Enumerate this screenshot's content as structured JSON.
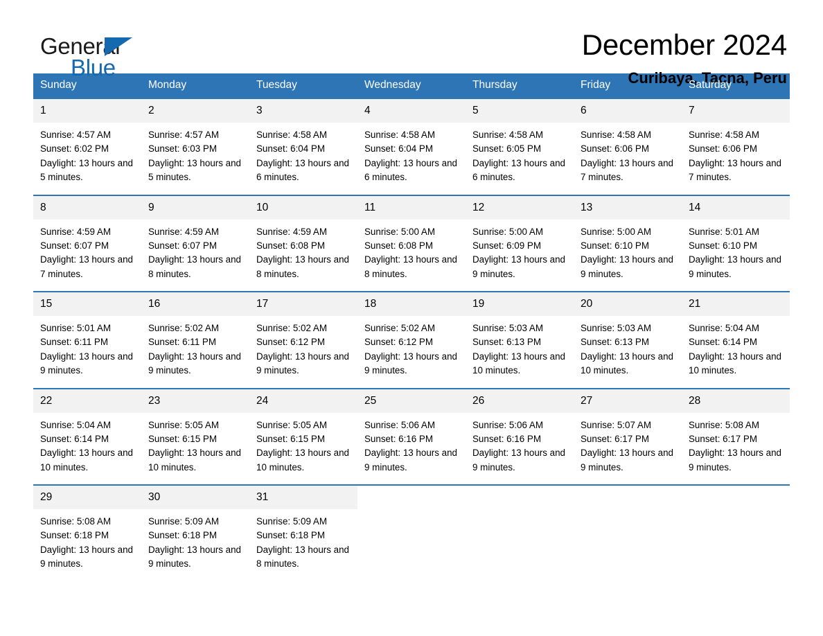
{
  "logo": {
    "word1": "General",
    "word2": "Blue",
    "accent_color": "#1569ae"
  },
  "header": {
    "title": "December 2024",
    "location": "Curibaya, Tacna, Peru"
  },
  "calendar": {
    "header_bg": "#2e75b6",
    "daynum_bg": "#f2f2f2",
    "weekdays": [
      "Sunday",
      "Monday",
      "Tuesday",
      "Wednesday",
      "Thursday",
      "Friday",
      "Saturday"
    ],
    "weeks": [
      [
        {
          "day": "1",
          "sunrise": "Sunrise: 4:57 AM",
          "sunset": "Sunset: 6:02 PM",
          "daylight": "Daylight: 13 hours and 5 minutes."
        },
        {
          "day": "2",
          "sunrise": "Sunrise: 4:57 AM",
          "sunset": "Sunset: 6:03 PM",
          "daylight": "Daylight: 13 hours and 5 minutes."
        },
        {
          "day": "3",
          "sunrise": "Sunrise: 4:58 AM",
          "sunset": "Sunset: 6:04 PM",
          "daylight": "Daylight: 13 hours and 6 minutes."
        },
        {
          "day": "4",
          "sunrise": "Sunrise: 4:58 AM",
          "sunset": "Sunset: 6:04 PM",
          "daylight": "Daylight: 13 hours and 6 minutes."
        },
        {
          "day": "5",
          "sunrise": "Sunrise: 4:58 AM",
          "sunset": "Sunset: 6:05 PM",
          "daylight": "Daylight: 13 hours and 6 minutes."
        },
        {
          "day": "6",
          "sunrise": "Sunrise: 4:58 AM",
          "sunset": "Sunset: 6:06 PM",
          "daylight": "Daylight: 13 hours and 7 minutes."
        },
        {
          "day": "7",
          "sunrise": "Sunrise: 4:58 AM",
          "sunset": "Sunset: 6:06 PM",
          "daylight": "Daylight: 13 hours and 7 minutes."
        }
      ],
      [
        {
          "day": "8",
          "sunrise": "Sunrise: 4:59 AM",
          "sunset": "Sunset: 6:07 PM",
          "daylight": "Daylight: 13 hours and 7 minutes."
        },
        {
          "day": "9",
          "sunrise": "Sunrise: 4:59 AM",
          "sunset": "Sunset: 6:07 PM",
          "daylight": "Daylight: 13 hours and 8 minutes."
        },
        {
          "day": "10",
          "sunrise": "Sunrise: 4:59 AM",
          "sunset": "Sunset: 6:08 PM",
          "daylight": "Daylight: 13 hours and 8 minutes."
        },
        {
          "day": "11",
          "sunrise": "Sunrise: 5:00 AM",
          "sunset": "Sunset: 6:08 PM",
          "daylight": "Daylight: 13 hours and 8 minutes."
        },
        {
          "day": "12",
          "sunrise": "Sunrise: 5:00 AM",
          "sunset": "Sunset: 6:09 PM",
          "daylight": "Daylight: 13 hours and 9 minutes."
        },
        {
          "day": "13",
          "sunrise": "Sunrise: 5:00 AM",
          "sunset": "Sunset: 6:10 PM",
          "daylight": "Daylight: 13 hours and 9 minutes."
        },
        {
          "day": "14",
          "sunrise": "Sunrise: 5:01 AM",
          "sunset": "Sunset: 6:10 PM",
          "daylight": "Daylight: 13 hours and 9 minutes."
        }
      ],
      [
        {
          "day": "15",
          "sunrise": "Sunrise: 5:01 AM",
          "sunset": "Sunset: 6:11 PM",
          "daylight": "Daylight: 13 hours and 9 minutes."
        },
        {
          "day": "16",
          "sunrise": "Sunrise: 5:02 AM",
          "sunset": "Sunset: 6:11 PM",
          "daylight": "Daylight: 13 hours and 9 minutes."
        },
        {
          "day": "17",
          "sunrise": "Sunrise: 5:02 AM",
          "sunset": "Sunset: 6:12 PM",
          "daylight": "Daylight: 13 hours and 9 minutes."
        },
        {
          "day": "18",
          "sunrise": "Sunrise: 5:02 AM",
          "sunset": "Sunset: 6:12 PM",
          "daylight": "Daylight: 13 hours and 9 minutes."
        },
        {
          "day": "19",
          "sunrise": "Sunrise: 5:03 AM",
          "sunset": "Sunset: 6:13 PM",
          "daylight": "Daylight: 13 hours and 10 minutes."
        },
        {
          "day": "20",
          "sunrise": "Sunrise: 5:03 AM",
          "sunset": "Sunset: 6:13 PM",
          "daylight": "Daylight: 13 hours and 10 minutes."
        },
        {
          "day": "21",
          "sunrise": "Sunrise: 5:04 AM",
          "sunset": "Sunset: 6:14 PM",
          "daylight": "Daylight: 13 hours and 10 minutes."
        }
      ],
      [
        {
          "day": "22",
          "sunrise": "Sunrise: 5:04 AM",
          "sunset": "Sunset: 6:14 PM",
          "daylight": "Daylight: 13 hours and 10 minutes."
        },
        {
          "day": "23",
          "sunrise": "Sunrise: 5:05 AM",
          "sunset": "Sunset: 6:15 PM",
          "daylight": "Daylight: 13 hours and 10 minutes."
        },
        {
          "day": "24",
          "sunrise": "Sunrise: 5:05 AM",
          "sunset": "Sunset: 6:15 PM",
          "daylight": "Daylight: 13 hours and 10 minutes."
        },
        {
          "day": "25",
          "sunrise": "Sunrise: 5:06 AM",
          "sunset": "Sunset: 6:16 PM",
          "daylight": "Daylight: 13 hours and 9 minutes."
        },
        {
          "day": "26",
          "sunrise": "Sunrise: 5:06 AM",
          "sunset": "Sunset: 6:16 PM",
          "daylight": "Daylight: 13 hours and 9 minutes."
        },
        {
          "day": "27",
          "sunrise": "Sunrise: 5:07 AM",
          "sunset": "Sunset: 6:17 PM",
          "daylight": "Daylight: 13 hours and 9 minutes."
        },
        {
          "day": "28",
          "sunrise": "Sunrise: 5:08 AM",
          "sunset": "Sunset: 6:17 PM",
          "daylight": "Daylight: 13 hours and 9 minutes."
        }
      ],
      [
        {
          "day": "29",
          "sunrise": "Sunrise: 5:08 AM",
          "sunset": "Sunset: 6:18 PM",
          "daylight": "Daylight: 13 hours and 9 minutes."
        },
        {
          "day": "30",
          "sunrise": "Sunrise: 5:09 AM",
          "sunset": "Sunset: 6:18 PM",
          "daylight": "Daylight: 13 hours and 9 minutes."
        },
        {
          "day": "31",
          "sunrise": "Sunrise: 5:09 AM",
          "sunset": "Sunset: 6:18 PM",
          "daylight": "Daylight: 13 hours and 8 minutes."
        },
        {
          "day": "",
          "sunrise": "",
          "sunset": "",
          "daylight": ""
        },
        {
          "day": "",
          "sunrise": "",
          "sunset": "",
          "daylight": ""
        },
        {
          "day": "",
          "sunrise": "",
          "sunset": "",
          "daylight": ""
        },
        {
          "day": "",
          "sunrise": "",
          "sunset": "",
          "daylight": ""
        }
      ]
    ]
  }
}
